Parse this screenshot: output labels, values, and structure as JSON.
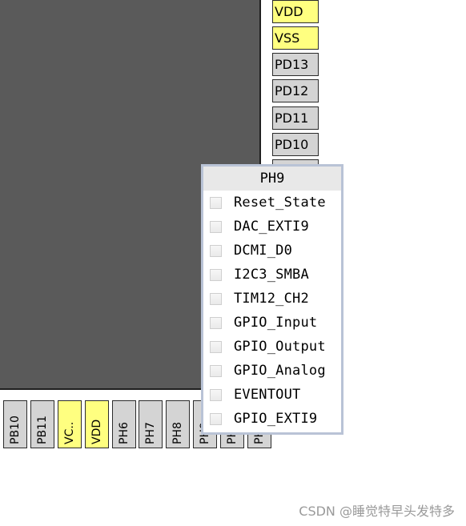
{
  "right_pins": [
    {
      "label": "VDD",
      "type": "power"
    },
    {
      "label": "VSS",
      "type": "power"
    },
    {
      "label": "PD13",
      "type": "io"
    },
    {
      "label": "PD12",
      "type": "io"
    },
    {
      "label": "PD11",
      "type": "io"
    },
    {
      "label": "PD10",
      "type": "io"
    }
  ],
  "bottom_pins": [
    {
      "label": "PB10",
      "type": "io"
    },
    {
      "label": "PB11",
      "type": "io"
    },
    {
      "label": "VC..",
      "type": "power"
    },
    {
      "label": "VDD",
      "type": "power"
    },
    {
      "label": "PH6",
      "type": "io"
    },
    {
      "label": "PH7",
      "type": "io"
    },
    {
      "label": "PH8",
      "type": "io"
    },
    {
      "label": "PH9",
      "type": "io"
    },
    {
      "label": "PH10",
      "type": "io"
    },
    {
      "label": "PH11",
      "type": "io"
    }
  ],
  "popup": {
    "title": "PH9",
    "items": [
      {
        "label": "Reset_State",
        "checked": false
      },
      {
        "label": "DAC_EXTI9",
        "checked": false
      },
      {
        "label": "DCMI_D0",
        "checked": false
      },
      {
        "label": "I2C3_SMBA",
        "checked": false
      },
      {
        "label": "TIM12_CH2",
        "checked": false
      },
      {
        "label": "GPIO_Input",
        "checked": false
      },
      {
        "label": "GPIO_Output",
        "checked": false
      },
      {
        "label": "GPIO_Analog",
        "checked": false
      },
      {
        "label": "EVENTOUT",
        "checked": false
      },
      {
        "label": "GPIO_EXTI9",
        "checked": false
      }
    ]
  },
  "watermark": "CSDN @睡觉特早头发特多",
  "colors": {
    "chip_body": "#5a5a5a",
    "power_pin": "#ffff80",
    "io_pin": "#d4d4d4",
    "popup_border": "#b9c3d6"
  }
}
